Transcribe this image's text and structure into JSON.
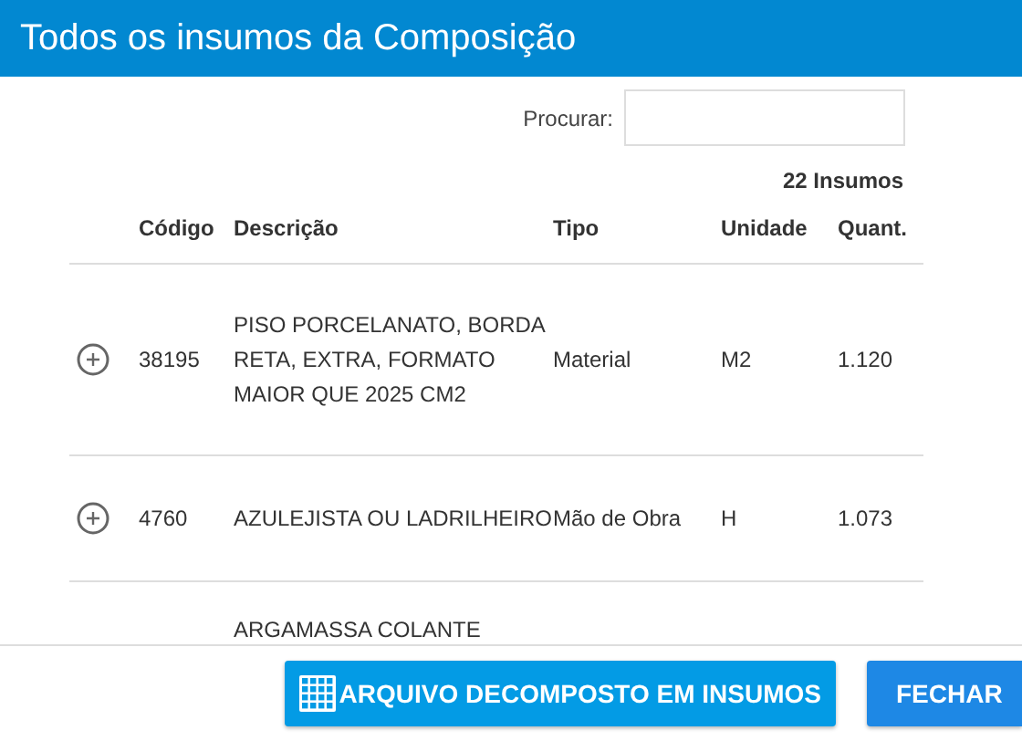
{
  "window": {
    "title": "Todos os insumos da Composição"
  },
  "search": {
    "label": "Procurar:"
  },
  "count": "22 Insumos",
  "table": {
    "columns": [
      "Código",
      "Descrição",
      "Tipo",
      "Unidade",
      "Quant."
    ],
    "rows": [
      {
        "cells": [
          "38195",
          "PISO PORCELANATO, BORDA RETA, EXTRA, FORMATO MAIOR QUE 2025 CM2",
          "Material",
          "M2",
          "1.120"
        ]
      },
      {
        "cells": [
          "4760",
          "AZULEJISTA OU LADRILHEIRO",
          "Mão de Obra",
          "H",
          "1.073"
        ]
      },
      {
        "cells": [
          "",
          "ARGAMASSA COLANTE",
          "",
          "",
          ""
        ]
      }
    ]
  },
  "buttons": [
    {
      "label": "ARQUIVO DECOMPOSTO EM INSUMOS",
      "kind": "grid"
    },
    {
      "label": "FECHAR",
      "kind": "plain"
    }
  ]
}
